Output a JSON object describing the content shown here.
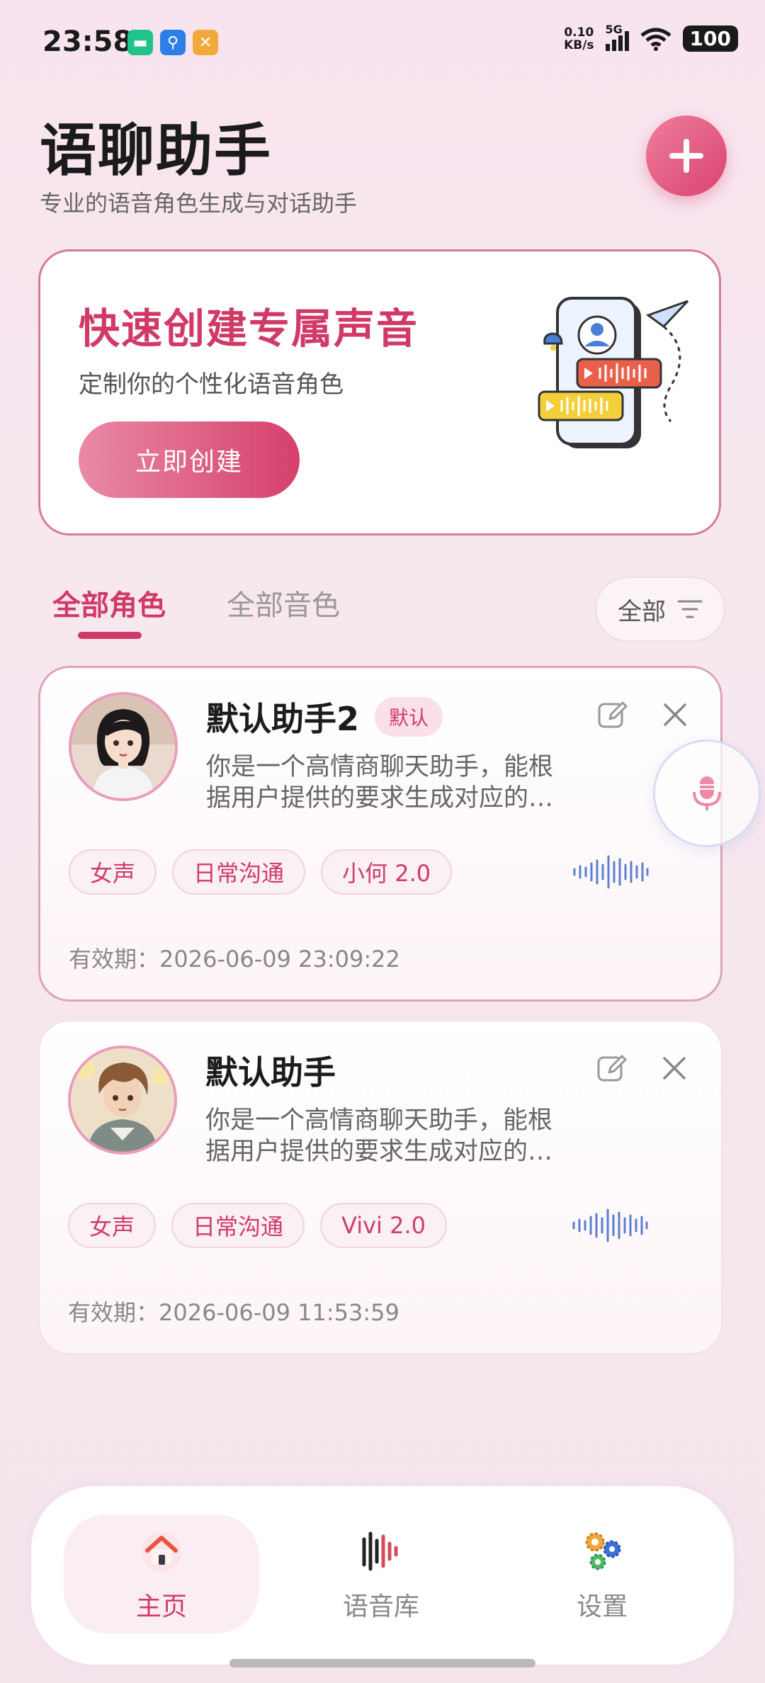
{
  "status_bar": {
    "time": "23:58",
    "net_speed_value": "0.10",
    "net_speed_unit": "KB/s",
    "network": "5G",
    "battery": "100"
  },
  "header": {
    "title": "语聊助手",
    "subtitle": "专业的语音角色生成与对话助手",
    "add_icon": "plus-icon"
  },
  "hero": {
    "title": "快速创建专属声音",
    "subtitle": "定制你的个性化语音角色",
    "button_label": "立即创建"
  },
  "tabs": {
    "items": [
      "全部角色",
      "全部音色"
    ],
    "active_index": 0,
    "filter_label": "全部"
  },
  "cards": [
    {
      "name": "默认助手2",
      "badge": "默认",
      "description": "你是一个高情商聊天助手，能根据用户提供的要求生成对应的…",
      "tags": [
        "女声",
        "日常沟通",
        "小何 2.0"
      ],
      "validity": "有效期：2026-06-09 23:09:22",
      "selected": true
    },
    {
      "name": "默认助手",
      "badge": "",
      "description": "你是一个高情商聊天助手，能根据用户提供的要求生成对应的…",
      "tags": [
        "女声",
        "日常沟通",
        "Vivi 2.0"
      ],
      "validity": "有效期：2026-06-09 11:53:59",
      "selected": false
    }
  ],
  "bottom_nav": {
    "items": [
      {
        "label": "主页",
        "icon": "home-icon",
        "active": true
      },
      {
        "label": "语音库",
        "icon": "voice-library-icon",
        "active": false
      },
      {
        "label": "设置",
        "icon": "settings-gear-icon",
        "active": false
      }
    ]
  },
  "colors": {
    "accent": "#d03a67",
    "accent_light": "#ef7d9d",
    "wave_blue": "#5b7fd0"
  }
}
